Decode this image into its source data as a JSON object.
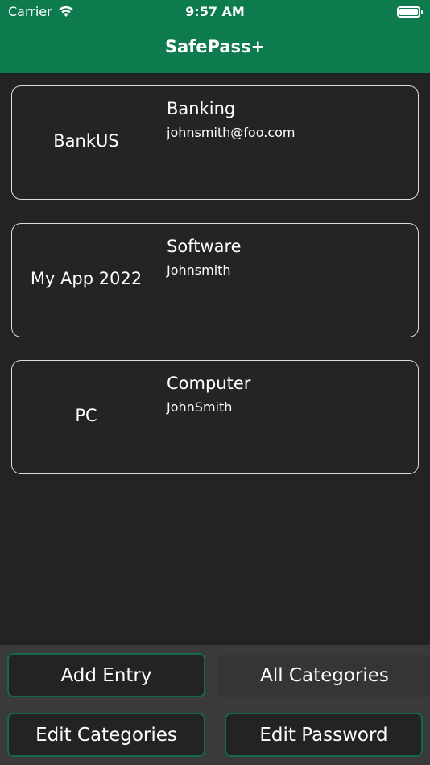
{
  "status_bar": {
    "carrier": "Carrier",
    "time": "9:57 AM"
  },
  "nav": {
    "title": "SafePass+"
  },
  "entries": [
    {
      "name": "BankUS",
      "category": "Banking",
      "username": "johnsmith@foo.com"
    },
    {
      "name": "My App 2022",
      "category": "Software",
      "username": "Johnsmith"
    },
    {
      "name": "PC",
      "category": "Computer",
      "username": "JohnSmith"
    }
  ],
  "toolbar": {
    "add_entry": "Add Entry",
    "all_categories": "All Categories",
    "edit_categories": "Edit Categories",
    "edit_password": "Edit Password"
  },
  "colors": {
    "brand_green": "#0e7b4f",
    "button_border": "#116b45",
    "background": "#232323"
  }
}
